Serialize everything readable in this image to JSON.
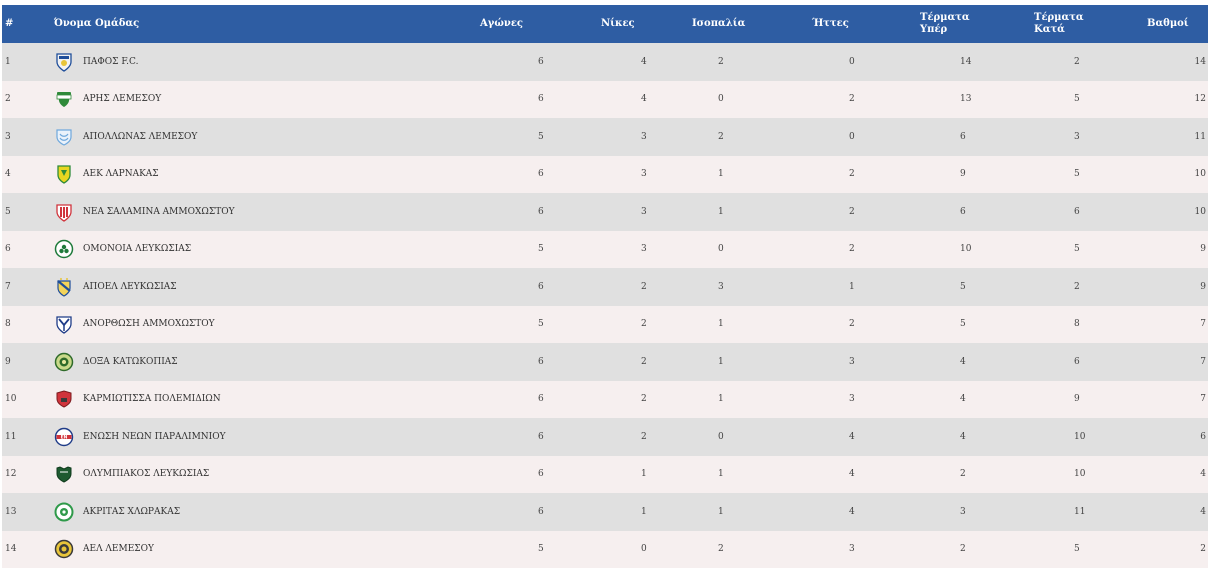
{
  "header": {
    "pos": "#",
    "team": "Όνομα Ομάδας",
    "played": "Αγώνες",
    "wins": "Νίκες",
    "draws": "Ισοπαλία",
    "losses": "Ήττες",
    "gf_line1": "Τέρματα",
    "gf_line2": "Υπέρ",
    "ga_line1": "Τέρματα",
    "ga_line2": "Κατά",
    "points": "Βαθμοί"
  },
  "rows": [
    {
      "pos": "1",
      "team": "ΠΑΦΟΣ F.C.",
      "logo": "pafos-crest-icon",
      "played": "6",
      "wins": "4",
      "draws": "2",
      "losses": "0",
      "gf": "14",
      "ga": "2",
      "pts": "14"
    },
    {
      "pos": "2",
      "team": "ΑΡΗΣ ΛΕΜΕΣΟΥ",
      "logo": "aris-crest-icon",
      "played": "6",
      "wins": "4",
      "draws": "0",
      "losses": "2",
      "gf": "13",
      "ga": "5",
      "pts": "12"
    },
    {
      "pos": "3",
      "team": "ΑΠΟΛΛΩΝΑΣ ΛΕΜΕΣΟΥ",
      "logo": "apollon-crest-icon",
      "played": "5",
      "wins": "3",
      "draws": "2",
      "losses": "0",
      "gf": "6",
      "ga": "3",
      "pts": "11"
    },
    {
      "pos": "4",
      "team": "ΑΕΚ ΛΑΡΝΑΚΑΣ",
      "logo": "aek-crest-icon",
      "played": "6",
      "wins": "3",
      "draws": "1",
      "losses": "2",
      "gf": "9",
      "ga": "5",
      "pts": "10"
    },
    {
      "pos": "5",
      "team": "ΝΕΑ ΣΑΛΑΜΙΝΑ ΑΜΜΟΧΩΣΤΟΥ",
      "logo": "nea-salamina-crest-icon",
      "played": "6",
      "wins": "3",
      "draws": "1",
      "losses": "2",
      "gf": "6",
      "ga": "6",
      "pts": "10"
    },
    {
      "pos": "6",
      "team": "ΟΜΟΝΟΙΑ ΛΕΥΚΩΣΙΑΣ",
      "logo": "omonoia-crest-icon",
      "played": "5",
      "wins": "3",
      "draws": "0",
      "losses": "2",
      "gf": "10",
      "ga": "5",
      "pts": "9"
    },
    {
      "pos": "7",
      "team": "ΑΠΟΕΛ ΛΕΥΚΩΣΙΑΣ",
      "logo": "apoel-crest-icon",
      "played": "6",
      "wins": "2",
      "draws": "3",
      "losses": "1",
      "gf": "5",
      "ga": "2",
      "pts": "9"
    },
    {
      "pos": "8",
      "team": "ΑΝΟΡΘΩΣΗ ΑΜΜΟΧΩΣΤΟΥ",
      "logo": "anorthosis-crest-icon",
      "played": "5",
      "wins": "2",
      "draws": "1",
      "losses": "2",
      "gf": "5",
      "ga": "8",
      "pts": "7"
    },
    {
      "pos": "9",
      "team": "ΔΟΞΑ ΚΑΤΩΚΟΠΙΑΣ",
      "logo": "doxa-crest-icon",
      "played": "6",
      "wins": "2",
      "draws": "1",
      "losses": "3",
      "gf": "4",
      "ga": "6",
      "pts": "7"
    },
    {
      "pos": "10",
      "team": "ΚΑΡΜΙΩΤΙΣΣΑ ΠΟΛΕΜΙΔΙΩΝ",
      "logo": "karmiotissa-crest-icon",
      "played": "6",
      "wins": "2",
      "draws": "1",
      "losses": "3",
      "gf": "4",
      "ga": "9",
      "pts": "7"
    },
    {
      "pos": "11",
      "team": "ΕΝΩΣΗ ΝΕΩΝ ΠΑΡΑΛΙΜΝΙΟΥ",
      "logo": "enp-crest-icon",
      "played": "6",
      "wins": "2",
      "draws": "0",
      "losses": "4",
      "gf": "4",
      "ga": "10",
      "pts": "6"
    },
    {
      "pos": "12",
      "team": "ΟΛΥΜΠΙΑΚΟΣ ΛΕΥΚΩΣΙΑΣ",
      "logo": "olympiakos-crest-icon",
      "played": "6",
      "wins": "1",
      "draws": "1",
      "losses": "4",
      "gf": "2",
      "ga": "10",
      "pts": "4"
    },
    {
      "pos": "13",
      "team": "ΑΚΡΙΤΑΣ ΧΛΩΡΑΚΑΣ",
      "logo": "akritas-crest-icon",
      "played": "6",
      "wins": "1",
      "draws": "1",
      "losses": "4",
      "gf": "3",
      "ga": "11",
      "pts": "4"
    },
    {
      "pos": "14",
      "team": "ΑΕΛ ΛΕΜΕΣΟΥ",
      "logo": "ael-crest-icon",
      "played": "5",
      "wins": "0",
      "draws": "2",
      "losses": "3",
      "gf": "2",
      "ga": "5",
      "pts": "2"
    }
  ],
  "colors": {
    "header_bg": "#2e5da3",
    "row_odd": "#e0e0e0",
    "row_even": "#f6efef"
  }
}
